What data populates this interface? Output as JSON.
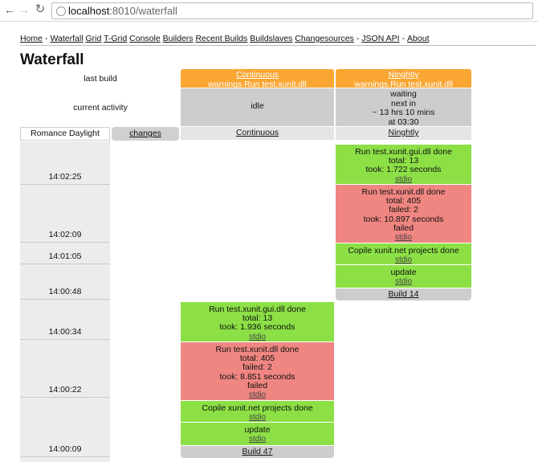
{
  "browser": {
    "url_host": "localhost",
    "url_rest": ":8010/waterfall"
  },
  "nav": {
    "home": "Home",
    "waterfall": "Waterfall",
    "grid": "Grid",
    "tgrid": "T-Grid",
    "console": "Console",
    "builders": "Builders",
    "recent_builds": "Recent Builds",
    "buildslaves": "Buildslaves",
    "changesources": "Changesources",
    "json_api": "JSON API",
    "about": "About",
    "sep": "-"
  },
  "page_title": "Waterfall",
  "labels": {
    "last_build": "last build",
    "current_activity": "current activity",
    "timezone": "Romance Daylight Time",
    "changes": "changes"
  },
  "builders": [
    {
      "name": "Continuous",
      "last_build_text": "warnings Run test.xunit.dll",
      "activity": [
        "idle"
      ]
    },
    {
      "name": "Ninghtly",
      "last_build_text": "warnings Run test.xunit.dll",
      "activity": [
        "waiting",
        "next in",
        "~ 13 hrs 10 mins",
        "at 03:30"
      ]
    }
  ],
  "times": [
    "14:02:25",
    "14:02:09",
    "14:01:05",
    "14:00:48",
    "14:00:34",
    "14:00:22",
    "14:00:09"
  ],
  "nightly_steps": [
    {
      "lines": [
        "Run test.xunit.gui.dll done",
        "total: 13",
        "took: 1.722 seconds"
      ],
      "link": "stdio",
      "status": "ok"
    },
    {
      "lines": [
        "Run test.xunit.dll done",
        "total: 405",
        "failed: 2",
        "took: 10.897 seconds",
        "failed"
      ],
      "link": "stdio",
      "status": "fail"
    },
    {
      "lines": [
        "Copile xunit.net projects done"
      ],
      "link": "stdio",
      "status": "ok"
    },
    {
      "lines": [
        "update"
      ],
      "link": "stdio",
      "status": "ok"
    }
  ],
  "nightly_build": "Build 14",
  "continuous_steps": [
    {
      "lines": [
        "Run test.xunit.gui.dll done",
        "total: 13",
        "took: 1.936 seconds"
      ],
      "link": "stdio",
      "status": "ok"
    },
    {
      "lines": [
        "Run test.xunit.dll done",
        "total: 405",
        "failed: 2",
        "took: 8.851 seconds",
        "failed"
      ],
      "link": "stdio",
      "status": "fail"
    },
    {
      "lines": [
        "Copile xunit.net projects done"
      ],
      "link": "stdio",
      "status": "ok"
    },
    {
      "lines": [
        "update"
      ],
      "link": "stdio",
      "status": "ok"
    }
  ],
  "continuous_build": "Build 47",
  "colors": {
    "success": "#8ce046",
    "failure": "#ef8682",
    "warnings": "#f9a633",
    "idle": "#cdcdcd"
  }
}
